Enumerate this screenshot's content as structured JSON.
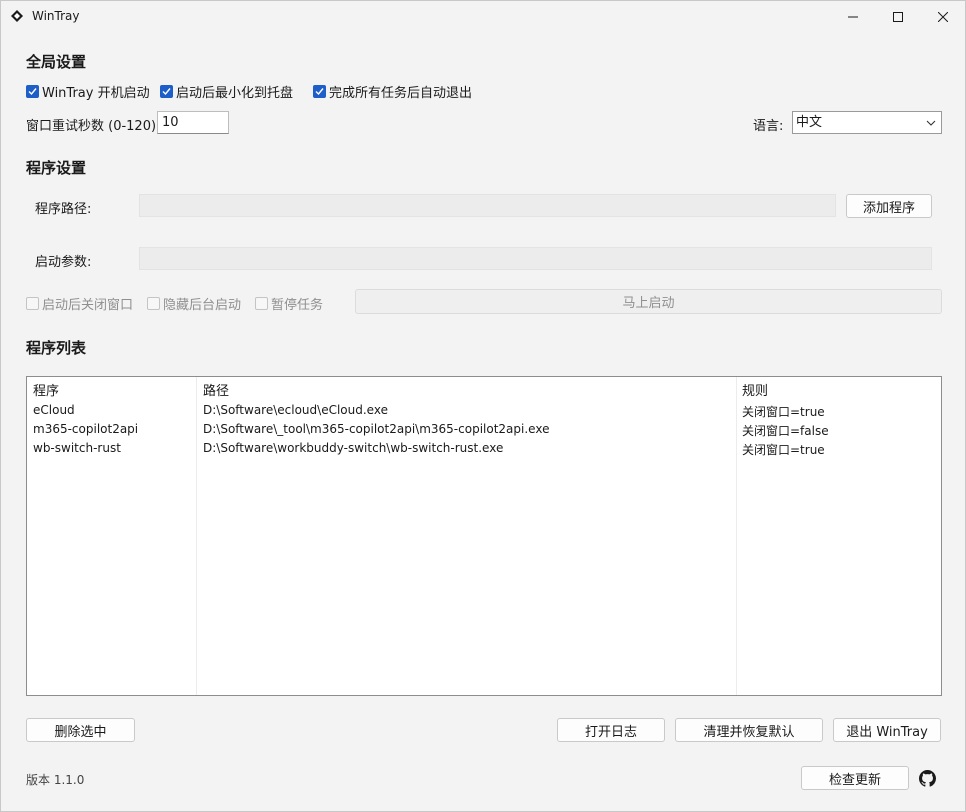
{
  "window": {
    "title": "WinTray"
  },
  "global_settings": {
    "title": "全局设置",
    "autostart_label": "WinTray 开机启动",
    "minimize_label": "启动后最小化到托盘",
    "auto_exit_label": "完成所有任务后自动退出",
    "retry_label": "窗口重试秒数 (0-120):",
    "retry_value": "10",
    "language_label": "语言:",
    "language_value": "中文"
  },
  "program_settings": {
    "title": "程序设置",
    "path_label": "程序路径:",
    "path_value": "",
    "add_button": "添加程序",
    "args_label": "启动参数:",
    "args_value": "",
    "close_window_label": "启动后关闭窗口",
    "hidden_label": "隐藏后台启动",
    "pause_label": "暂停任务",
    "launch_button": "马上启动"
  },
  "program_list": {
    "title": "程序列表",
    "headers": {
      "program": "程序",
      "path": "路径",
      "rule": "规则"
    },
    "rows": [
      {
        "program": "eCloud",
        "path": "D:\\Software\\ecloud\\eCloud.exe",
        "rule": "关闭窗口=true"
      },
      {
        "program": "m365-copilot2api",
        "path": "D:\\Software\\_tool\\m365-copilot2api\\m365-copilot2api.exe",
        "rule": "关闭窗口=false"
      },
      {
        "program": "wb-switch-rust",
        "path": "D:\\Software\\workbuddy-switch\\wb-switch-rust.exe",
        "rule": "关闭窗口=true"
      }
    ]
  },
  "actions": {
    "delete_button": "删除选中",
    "open_log_button": "打开日志",
    "reset_button": "清理并恢复默认",
    "exit_button": "退出 WinTray"
  },
  "footer": {
    "version": "版本 1.1.0",
    "check_update_button": "检查更新"
  },
  "colors": {
    "accent": "#1d5ec9",
    "background": "#f3f3f3"
  },
  "icons": {
    "app": "app-diamond-icon",
    "github": "github-icon"
  }
}
